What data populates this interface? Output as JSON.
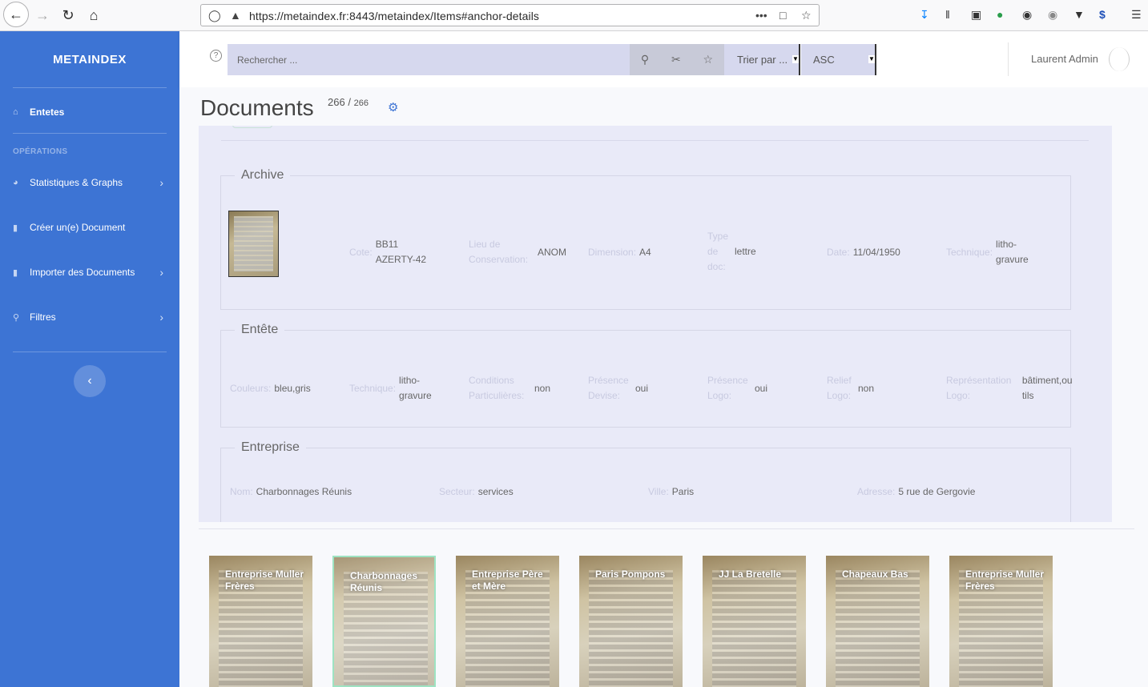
{
  "browser": {
    "url": "https://metaindex.fr:8443/metaindex/Items#anchor-details",
    "more_icon": "•••"
  },
  "sidebar": {
    "brand": "METAINDEX",
    "home_label": "Entetes",
    "operations_heading": "OPÉRATIONS",
    "items": [
      {
        "label": "Statistiques & Graphs",
        "icon": "pie-chart-icon"
      },
      {
        "label": "Créer un(e) Document",
        "icon": "document-icon"
      },
      {
        "label": "Importer des Documents",
        "icon": "file-import-icon"
      },
      {
        "label": "Filtres",
        "icon": "search-icon"
      }
    ]
  },
  "topbar": {
    "help": "?",
    "search_placeholder": "Rechercher ...",
    "sort_label": "Trier par ...",
    "order_label": "ASC",
    "user_name": "Laurent Admin"
  },
  "main": {
    "title": "Documents",
    "count_shown": "266",
    "count_sep": "/",
    "count_total": "266"
  },
  "details": {
    "archive": {
      "legend": "Archive",
      "fields": [
        {
          "key": "Cote:",
          "value": "BB11 AZERTY-42"
        },
        {
          "key": "Lieu de Conservation:",
          "value": "ANOM"
        },
        {
          "key": "Dimension:",
          "value": "A4"
        },
        {
          "key": "Type de doc:",
          "value": "lettre"
        },
        {
          "key": "Date:",
          "value": "11/04/1950"
        },
        {
          "key": "Technique:",
          "value": "litho-gravure"
        }
      ]
    },
    "entete": {
      "legend": "Entête",
      "fields": [
        {
          "key": "Couleurs:",
          "value": "bleu,gris"
        },
        {
          "key": "Technique:",
          "value": "litho-gravure"
        },
        {
          "key": "Conditions Particulières:",
          "value": "non"
        },
        {
          "key": "Présence Devise:",
          "value": "oui"
        },
        {
          "key": "Présence Logo:",
          "value": "oui"
        },
        {
          "key": "Relief Logo:",
          "value": "non"
        },
        {
          "key": "Représentation Logo:",
          "value": "bâtiment,outils"
        }
      ]
    },
    "entreprise": {
      "legend": "Entreprise",
      "fields": [
        {
          "key": "Nom:",
          "value": "Charbonnages Réunis"
        },
        {
          "key": "Secteur:",
          "value": "services"
        },
        {
          "key": "Ville:",
          "value": "Paris"
        },
        {
          "key": "Adresse:",
          "value": "5 rue de Gergovie"
        }
      ]
    }
  },
  "cards": [
    {
      "title": "Entreprise Muller Frères"
    },
    {
      "title": "Charbonnages Réunis"
    },
    {
      "title": "Entreprise Père et Mère"
    },
    {
      "title": "Paris Pompons"
    },
    {
      "title": "JJ La Bretelle"
    },
    {
      "title": "Chapeaux Bas"
    },
    {
      "title": "Entreprise Muller Frères"
    }
  ]
}
